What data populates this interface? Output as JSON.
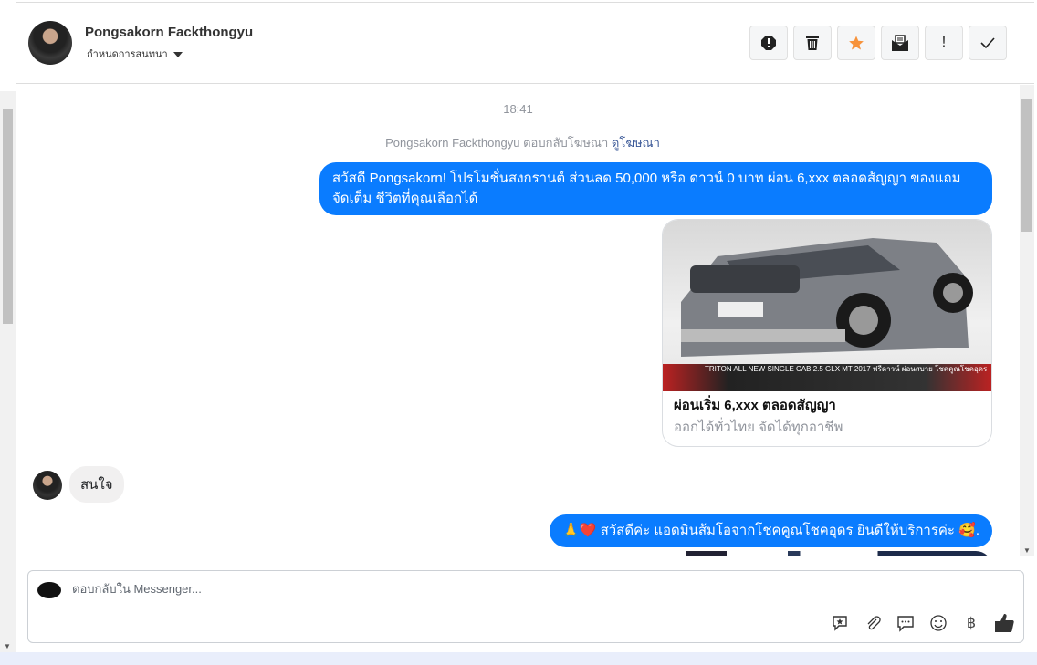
{
  "header": {
    "contact_name": "Pongsakorn Fackthongyu",
    "subtitle": "กำหนดการสนทนา",
    "actions": [
      {
        "name": "spam",
        "icon": "alert-octagon-icon"
      },
      {
        "name": "delete",
        "icon": "trash-icon"
      },
      {
        "name": "star",
        "icon": "star-icon",
        "color": "#f7923a"
      },
      {
        "name": "mark-unread",
        "icon": "envelope-open-icon"
      },
      {
        "name": "follow-up",
        "icon": "exclamation-icon"
      },
      {
        "name": "done",
        "icon": "check-icon"
      }
    ]
  },
  "conversation": {
    "timestamp": "18:41",
    "ad_reply_text": "Pongsakorn Fackthongyu ตอบกลับโฆษณา",
    "ad_link": "ดูโฆษณา",
    "messages": [
      {
        "from": "page",
        "text": "สวัสดี Pongsakorn! โปรโมชั่นสงกรานต์ ส่วนลด 50,000 หรือ ดาวน์ 0 บาท ผ่อน 6,xxx ตลอดสัญญา ของแถม จัดเต็ม ชีวิตที่คุณเลือกได้"
      },
      {
        "from": "page",
        "type": "card",
        "title": "ผ่อนเริ่ม 6,xxx ตลอดสัญญา",
        "subtitle": "ออกได้ทั่วไทย จัดได้ทุกอาชีพ",
        "image_caption": "TRITON ALL NEW SINGLE CAB 2.5 GLX MT 2017 ฟรีดาวน์ ผ่อนสบาย  โชคคูณโชคอุดร"
      },
      {
        "from": "user",
        "text": "สนใจ"
      },
      {
        "from": "page",
        "text": "🙏❤️ สวัสดีค่ะ แอดมินส้มโอจากโชคคูณโชคอุดร ยินดีให้บริการค่ะ 🥰."
      }
    ],
    "bubble_color": "#0a7cff"
  },
  "composer": {
    "placeholder": "ตอบกลับใน Messenger...",
    "value": "",
    "tools": [
      "saved-reply-icon",
      "attachment-icon",
      "chat-bubble-icon",
      "emoji-icon",
      "baht-icon",
      "thumbs-up-icon"
    ],
    "baht_symbol": "฿"
  }
}
